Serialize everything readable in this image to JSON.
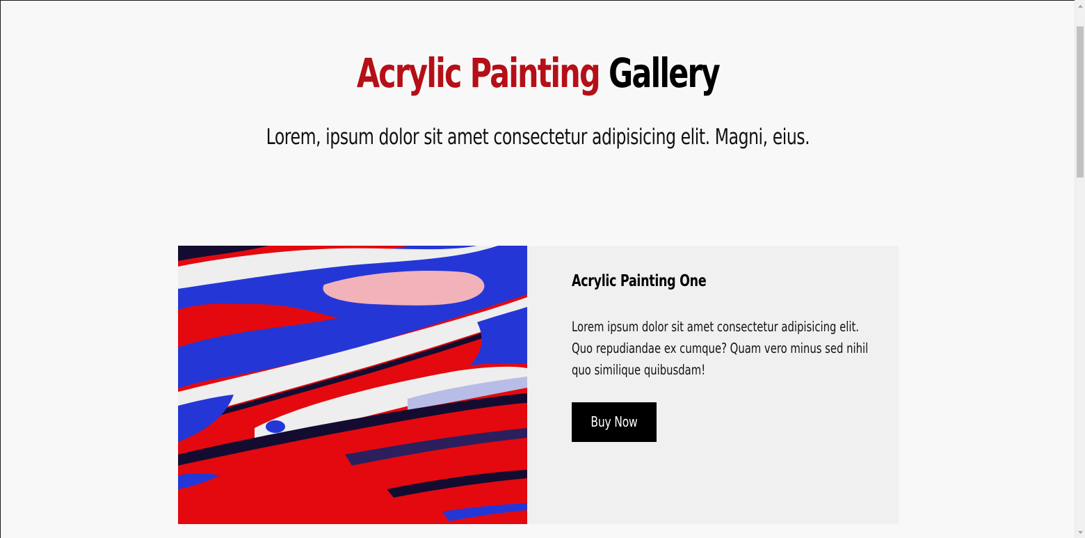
{
  "header": {
    "title_accent": "Acrylic Painting",
    "title_rest": "Gallery",
    "subtitle": "Lorem, ipsum dolor sit amet consectetur adipisicing elit. Magni, eius."
  },
  "card": {
    "title": "Acrylic Painting One",
    "description_lines": [
      "Lorem ipsum dolor sit amet consectetur adipisicing elit.",
      "Quo repudiandae ex cumque? Quam vero minus sed nihil",
      "quo similique quibusdam!"
    ],
    "button_label": "Buy Now"
  },
  "colors": {
    "accent": "#b50f17",
    "button": "#000000",
    "card_background": "#f0f0f0",
    "page_background": "#f8f8f8",
    "paint_red": "#e4090f",
    "paint_blue": "#2437d6",
    "paint_white": "#eeeeee",
    "paint_pink": "#f2b2ba",
    "paint_dark": "#140c30"
  },
  "icons": {
    "scroll_up": "triangle-up-icon",
    "scroll_down": "triangle-down-icon"
  },
  "scroll": {
    "position_fraction": 0.0
  }
}
